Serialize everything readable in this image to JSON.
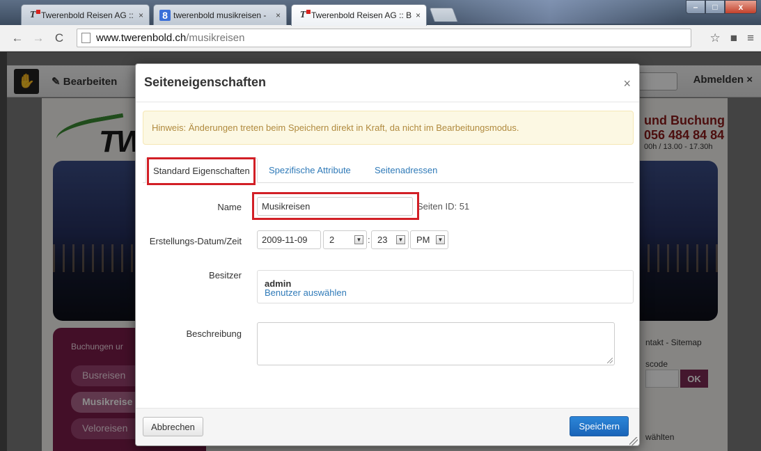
{
  "browser": {
    "tabs": [
      {
        "label": "Twerenbold Reisen AG :: B",
        "icon": "twerenbold-favicon",
        "close": "×"
      },
      {
        "label": "twerenbold musikreisen -",
        "icon": "google-favicon",
        "close": "×"
      },
      {
        "label": "Twerenbold Reisen AG :: B",
        "icon": "twerenbold-favicon",
        "close": "×"
      }
    ],
    "url_host": "www.twerenbold.ch",
    "url_path": "/musikreisen",
    "window_buttons": {
      "min": "–",
      "max": "□",
      "close": "x"
    }
  },
  "cms_bar": {
    "edit_label": "Bearbeiten",
    "logout_label": "Abmelden ×"
  },
  "site": {
    "booking_title": "und Buchung",
    "booking_phone": "056 484 84 84",
    "booking_hours": "00h / 13.00 - 17.30h",
    "menu_heading": "Buchungen ur",
    "menu_items": [
      "Busreisen",
      "Musikreise",
      "Veloreisen"
    ],
    "side_links": "ntakt - Sitemap",
    "side_code": "scode",
    "ok_label": "OK",
    "side_bottom": "wählten"
  },
  "modal": {
    "title": "Seiteneigenschaften",
    "close": "×",
    "alert": "Hinweis: Änderungen treten beim Speichern direkt in Kraft, da nicht im Bearbeitungsmodus.",
    "tabs": [
      "Standard Eigenschaften",
      "Spezifische Attribute",
      "Seitenadressen"
    ],
    "name_label": "Name",
    "name_value": "Musikreisen",
    "page_id": "Seiten ID: 51",
    "date_label": "Erstellungs-Datum/Zeit",
    "date_value": "2009-11-09",
    "hour": "2",
    "minute": "23",
    "ampm": "PM",
    "owner_label": "Besitzer",
    "owner_name": "admin",
    "owner_link": "Benutzer auswählen",
    "desc_label": "Beschreibung",
    "cancel_label": "Abbrechen",
    "save_label": "Speichern"
  },
  "colors": {
    "highlight": "#d21f26",
    "primary": "#1a64b8",
    "link": "#2f7ab8",
    "alert_bg": "#fcf8e3",
    "alert_text": "#b08a3e"
  }
}
